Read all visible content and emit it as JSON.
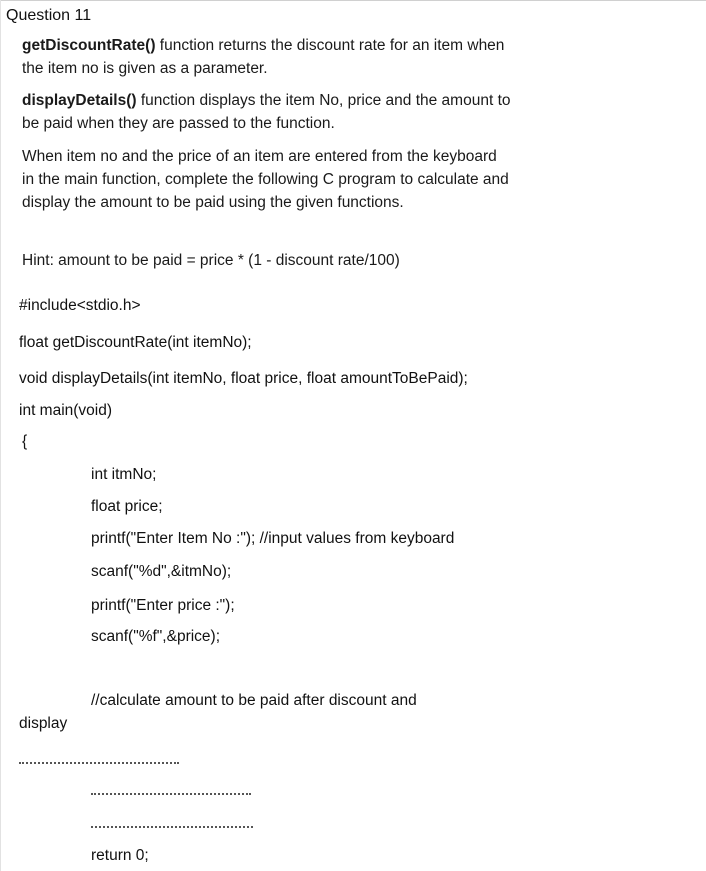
{
  "question": {
    "title": "Question 11"
  },
  "intro": {
    "p1_name": "getDiscountRate()",
    "p1_line1_rest": " function returns the discount rate for an item when",
    "p1_line2": "the item no is given as a parameter.",
    "p2_name": "displayDetails()",
    "p2_line1_rest": " function displays the item No, price and the amount to",
    "p2_line2": "be paid when they are passed to the function.",
    "p3_line1": "When item no and the price of an item are entered from the keyboard",
    "p3_line2": "in the main function, complete the following C program to calculate and",
    "p3_line3": "display the amount to be paid using the given functions.",
    "hint": "Hint:  amount to be paid =  price * (1 - discount rate/100)"
  },
  "code": {
    "include": "#include<stdio.h>",
    "proto1": "float getDiscountRate(int itemNo);",
    "proto2": "void displayDetails(int itemNo, float price, float amountToBePaid);",
    "main_sig": "int main(void)",
    "open_brace": "{",
    "decl1": "int itmNo;",
    "decl2": "float price;",
    "printf1": "printf(\"Enter Item No :\");  //input values from keyboard",
    "scanf1": "scanf(\"%d\",&itmNo);",
    "printf2": "printf(\"Enter price :\");",
    "scanf2": "scanf(\"%f\",&price);",
    "comment_line1": "//calculate amount to be paid after discount and",
    "comment_line2": "display",
    "return_stmt": "return 0;"
  }
}
